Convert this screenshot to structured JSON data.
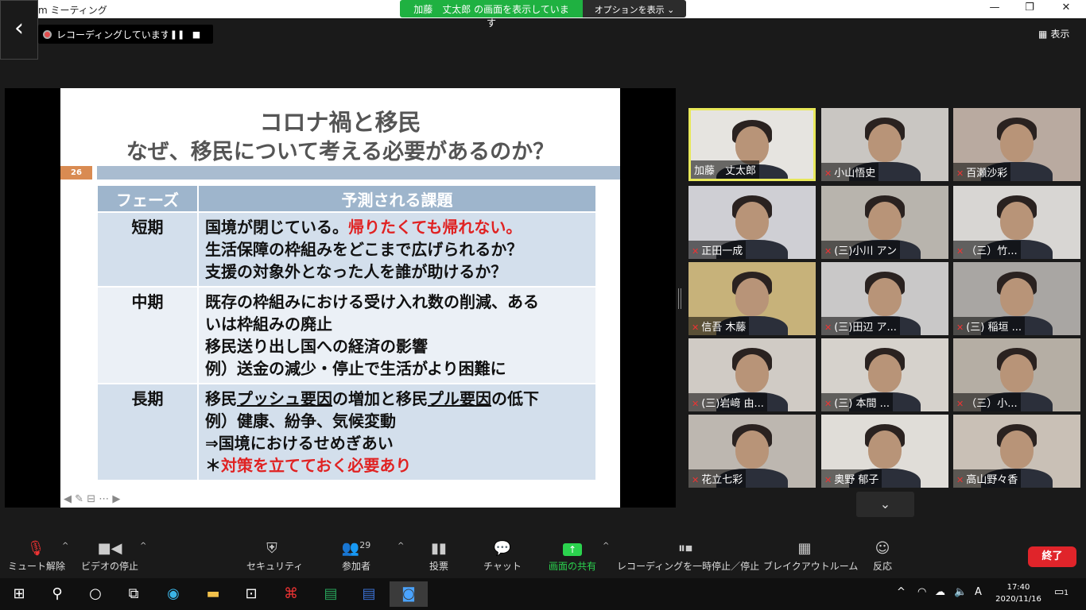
{
  "window": {
    "title": "m ミーティング"
  },
  "share_bar": {
    "sharing_label": "加藤　丈太郎 の画面を表示しています",
    "options_label": "オプションを表示 ⌄"
  },
  "recording": {
    "status": "レコーディングしています...",
    "pause": "❚❚",
    "stop": "■"
  },
  "view_button": {
    "label": "表示"
  },
  "slide": {
    "title_line1": "コロナ禍と移民",
    "title_line2": "なぜ、移民について考える必要があるのか？",
    "page_number": "26",
    "table_headers": [
      "フェーズ",
      "予測される課題"
    ],
    "rows": [
      {
        "phase": "短期",
        "line1_a": "国境が閉じている。",
        "line1_red": "帰りたくても帰れない。",
        "line2": "生活保障の枠組みをどこまで広げられるか？",
        "line3": "支援の対象外となった人を誰が助けるか？"
      },
      {
        "phase": "中期",
        "line1": "既存の枠組みにおける受け入れ数の削減、ある",
        "line2": "いは枠組みの廃止",
        "line3": "移民送り出し国への経済の影響",
        "line4": "例）送金の減少・停止で生活がより困難に"
      },
      {
        "phase": "長期",
        "l1_a": "移民",
        "l1_b": "プッシュ要因",
        "l1_c": "の増加と移民",
        "l1_d": "プル要因",
        "l1_e": "の低下",
        "line2": "例）健康、紛争、気候変動",
        "line3": "⇒国境におけるせめぎあい",
        "line4_star": "＊",
        "line4_red": "対策を立てておく必要あり"
      }
    ]
  },
  "participants": [
    {
      "name": "加藤　丈太郎",
      "muted": false
    },
    {
      "name": "小山悟史",
      "muted": true
    },
    {
      "name": "百瀬沙彩",
      "muted": true
    },
    {
      "name": "正田一成",
      "muted": true
    },
    {
      "name": "(三)小川 アン",
      "muted": true
    },
    {
      "name": "（三）竹...",
      "muted": true
    },
    {
      "name": "信吾 木藤",
      "muted": true
    },
    {
      "name": "(三)田辺 ア...",
      "muted": true
    },
    {
      "name": "(三) 稲垣 ...",
      "muted": true
    },
    {
      "name": "(三)岩﨑 由...",
      "muted": true
    },
    {
      "name": "(三) 本間 ...",
      "muted": true
    },
    {
      "name": "（三）小...",
      "muted": true
    },
    {
      "name": "花立七彩",
      "muted": true
    },
    {
      "name": "奥野 郁子",
      "muted": true
    },
    {
      "name": "高山野々香",
      "muted": true
    }
  ],
  "toolbar": {
    "mute": "ミュート解除",
    "video": "ビデオの停止",
    "security": "セキュリティ",
    "participants": "参加者",
    "participants_count": "29",
    "poll": "投票",
    "chat": "チャット",
    "share": "画面の共有",
    "pause_recording": "レコーディングを一時停止／停止",
    "breakout": "ブレイクアウトルーム",
    "reactions": "反応",
    "end": "終了"
  },
  "taskbar": {
    "time": "17:40",
    "date": "2020/11/16",
    "ime": "A",
    "notifications": "1"
  }
}
